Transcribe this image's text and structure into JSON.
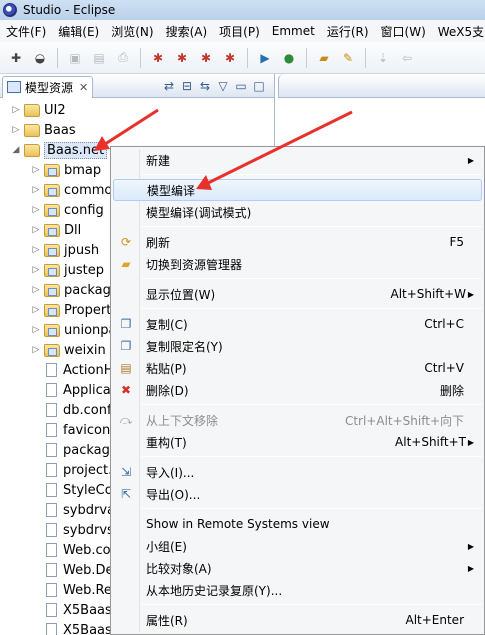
{
  "window": {
    "title": "Studio - Eclipse"
  },
  "menubar": [
    "文件(F)",
    "编辑(E)",
    "浏览(N)",
    "搜索(A)",
    "项目(P)",
    "Emmet",
    "运行(R)",
    "窗口(W)",
    "WeX5支"
  ],
  "toolbar": {
    "icons": [
      "new-icon",
      "run-icon",
      "save-icon",
      "save-all-icon",
      "print-icon",
      "tool-a-icon",
      "tool-b-icon",
      "tool-c-icon",
      "tool-d-icon",
      "play-icon",
      "debug-icon",
      "open-folder-icon",
      "build-icon",
      "nav-icon",
      "back-icon"
    ]
  },
  "panel": {
    "tab_label": "模型资源",
    "tools": [
      "⇄",
      "⊟",
      "⇆",
      "▽",
      "▭",
      "□"
    ]
  },
  "tree": [
    {
      "label": "UI2",
      "type": "folder",
      "expander": "▷"
    },
    {
      "label": "Baas",
      "type": "folder",
      "expander": "▷"
    },
    {
      "label": "Baas.net",
      "type": "folder",
      "expander": "◢",
      "selected": true
    },
    {
      "label": "bmap",
      "type": "folder",
      "expander": "▷"
    },
    {
      "label": "commo",
      "type": "folder",
      "expander": "▷"
    },
    {
      "label": "config",
      "type": "folder",
      "expander": "▷"
    },
    {
      "label": "Dll",
      "type": "folder",
      "expander": "▷"
    },
    {
      "label": "jpush",
      "type": "folder",
      "expander": "▷"
    },
    {
      "label": "justep",
      "type": "folder",
      "expander": "▷"
    },
    {
      "label": "packag",
      "type": "folder",
      "expander": "▷"
    },
    {
      "label": "Propert",
      "type": "folder",
      "expander": "▷"
    },
    {
      "label": "unionpa",
      "type": "folder",
      "expander": "▷"
    },
    {
      "label": "weixin",
      "type": "folder",
      "expander": "▷"
    },
    {
      "label": "ActionH",
      "type": "file"
    },
    {
      "label": "Applicat",
      "type": "file"
    },
    {
      "label": "db.confi",
      "type": "file"
    },
    {
      "label": "favicon.",
      "type": "file"
    },
    {
      "label": "packag",
      "type": "file"
    },
    {
      "label": "project.",
      "type": "file"
    },
    {
      "label": "StyleCo",
      "type": "file"
    },
    {
      "label": "sybdrva",
      "type": "file"
    },
    {
      "label": "sybdrvs",
      "type": "file"
    },
    {
      "label": "Web.co",
      "type": "file"
    },
    {
      "label": "Web.De",
      "type": "file"
    },
    {
      "label": "Web.Re",
      "type": "file"
    },
    {
      "label": "X5Baas",
      "type": "file"
    },
    {
      "label": "X5Baas",
      "type": "file"
    }
  ],
  "context_menu": [
    {
      "label": "新建",
      "shortcut": "",
      "submenu": true,
      "icon": ""
    },
    {
      "separator": true
    },
    {
      "label": "模型编译",
      "shortcut": "",
      "highlight": true
    },
    {
      "label": "模型编译(调试模式)",
      "shortcut": ""
    },
    {
      "separator": true
    },
    {
      "label": "刷新",
      "shortcut": "F5",
      "icon": "refresh-icon"
    },
    {
      "label": "切换到资源管理器",
      "shortcut": "",
      "icon": "folder-icon"
    },
    {
      "separator": true
    },
    {
      "label": "显示位置(W)",
      "shortcut": "Alt+Shift+W",
      "submenu": true
    },
    {
      "separator": true
    },
    {
      "label": "复制(C)",
      "shortcut": "Ctrl+C",
      "icon": "copy-icon"
    },
    {
      "label": "复制限定名(Y)",
      "shortcut": "",
      "icon": "copy-qualified-icon"
    },
    {
      "label": "粘贴(P)",
      "shortcut": "Ctrl+V",
      "icon": "paste-icon"
    },
    {
      "label": "删除(D)",
      "shortcut": "删除",
      "icon": "delete-icon"
    },
    {
      "separator": true
    },
    {
      "label": "从上下文移除",
      "shortcut": "Ctrl+Alt+Shift+向下",
      "disabled": true,
      "icon": "remove-context-icon"
    },
    {
      "label": "重构(T)",
      "shortcut": "Alt+Shift+T",
      "submenu": true
    },
    {
      "separator": true
    },
    {
      "label": "导入(I)...",
      "shortcut": "",
      "icon": "import-icon"
    },
    {
      "label": "导出(O)...",
      "shortcut": "",
      "icon": "export-icon"
    },
    {
      "separator": true
    },
    {
      "label": "Show in Remote Systems view",
      "shortcut": ""
    },
    {
      "label": "小组(E)",
      "shortcut": "",
      "submenu": true
    },
    {
      "label": "比较对象(A)",
      "shortcut": "",
      "submenu": true
    },
    {
      "label": "从本地历史记录复原(Y)...",
      "shortcut": ""
    },
    {
      "separator": true
    },
    {
      "label": "属性(R)",
      "shortcut": "Alt+Enter"
    }
  ],
  "colors": {
    "annotation_arrow": "#e8312b",
    "highlight": "#dceafb"
  }
}
